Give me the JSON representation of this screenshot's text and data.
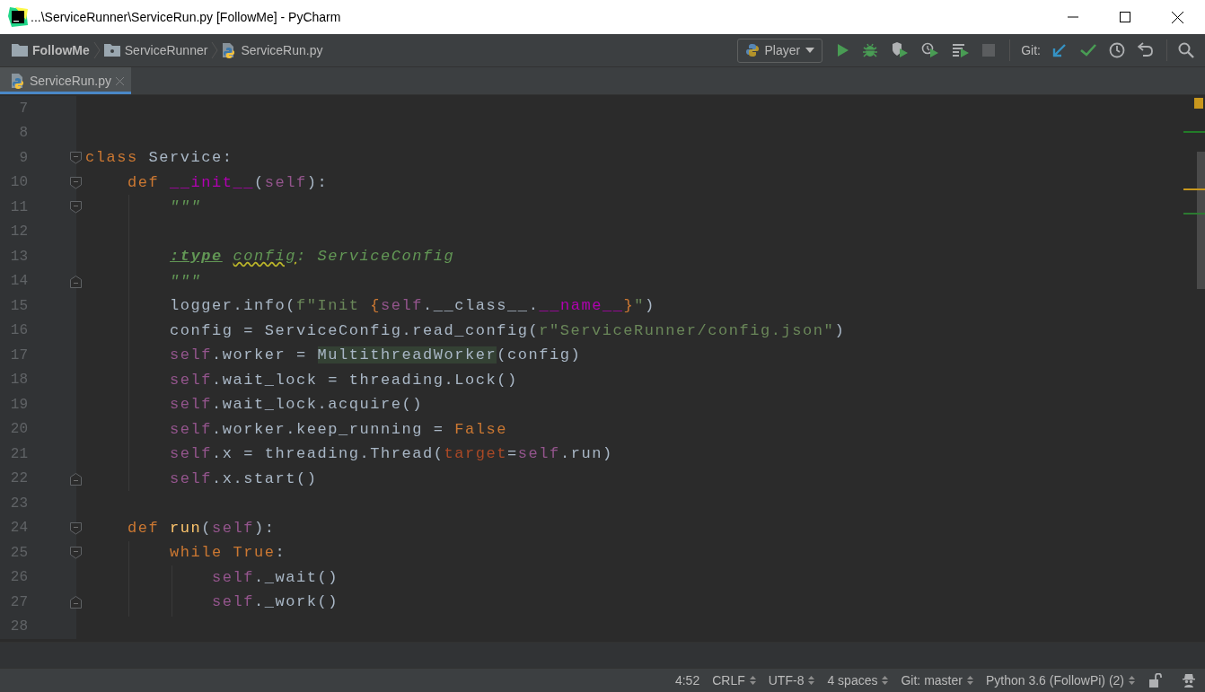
{
  "window": {
    "title": "...\\ServiceRunner\\ServiceRun.py [FollowMe] - PyCharm"
  },
  "breadcrumbs": [
    {
      "label": "FollowMe",
      "kind": "project"
    },
    {
      "label": "ServiceRunner",
      "kind": "package"
    },
    {
      "label": "ServiceRun.py",
      "kind": "file"
    }
  ],
  "run_configuration": {
    "label": "Player"
  },
  "toolbar": {
    "git_label": "Git:"
  },
  "tabs": [
    {
      "label": "ServiceRun.py",
      "selected": true
    }
  ],
  "editor": {
    "lines": [
      {
        "number": "7",
        "fold_start": false,
        "fold_end": false
      },
      {
        "number": "8",
        "fold_start": false,
        "fold_end": false
      },
      {
        "number": "9",
        "fold_start": true,
        "fold_end": false,
        "tokens": [
          {
            "text": "class",
            "kind": "keyword"
          },
          {
            "text": " Service:",
            "kind": "plain"
          }
        ]
      },
      {
        "number": "10",
        "fold_start": true,
        "fold_end": false,
        "tokens": [
          {
            "text": "    def ",
            "kind": "keyword"
          },
          {
            "text": "__init__",
            "kind": "magic"
          },
          {
            "text": "(",
            "kind": "plain"
          },
          {
            "text": "self",
            "kind": "self"
          },
          {
            "text": "):",
            "kind": "plain"
          }
        ]
      },
      {
        "number": "11",
        "fold_start": true,
        "fold_end": false,
        "tokens": [
          {
            "text": "        \"\"\"",
            "kind": "doc"
          }
        ]
      },
      {
        "number": "12",
        "fold_start": false,
        "fold_end": false
      },
      {
        "number": "13",
        "fold_start": false,
        "fold_end": false,
        "tokens": [
          {
            "text": "        :type ",
            "kind": "doctag"
          },
          {
            "text": "config",
            "kind": "docwarn"
          },
          {
            "text": ": ServiceConfig",
            "kind": "doc"
          }
        ]
      },
      {
        "number": "14",
        "fold_start": false,
        "fold_end": true,
        "tokens": [
          {
            "text": "        \"\"\"",
            "kind": "doc"
          }
        ]
      },
      {
        "number": "15",
        "fold_start": false,
        "fold_end": false,
        "tokens": [
          {
            "text": "        logger.info(",
            "kind": "plain"
          },
          {
            "text": "f\"Init ",
            "kind": "string"
          },
          {
            "text": "{",
            "kind": "brace"
          },
          {
            "text": "self",
            "kind": "self"
          },
          {
            "text": ".__class__.",
            "kind": "plain"
          },
          {
            "text": "__name__",
            "kind": "magic"
          },
          {
            "text": "}",
            "kind": "brace"
          },
          {
            "text": "\"",
            "kind": "string"
          },
          {
            "text": ")",
            "kind": "plain"
          }
        ]
      },
      {
        "number": "16",
        "fold_start": false,
        "fold_end": false,
        "tokens": [
          {
            "text": "        config = ServiceConfig.read_config(",
            "kind": "plain"
          },
          {
            "text": "r\"ServiceRunner/config.json\"",
            "kind": "string"
          },
          {
            "text": ")",
            "kind": "plain"
          }
        ]
      },
      {
        "number": "17",
        "fold_start": false,
        "fold_end": false,
        "tokens": [
          {
            "text": "        self",
            "kind": "self"
          },
          {
            "text": ".worker = ",
            "kind": "plain"
          },
          {
            "text": "MultithreadWorker",
            "kind": "highlight"
          },
          {
            "text": "(config)",
            "kind": "plain"
          }
        ]
      },
      {
        "number": "18",
        "fold_start": false,
        "fold_end": false,
        "tokens": [
          {
            "text": "        self",
            "kind": "self"
          },
          {
            "text": ".wait_lock = threading.Lock()",
            "kind": "plain"
          }
        ]
      },
      {
        "number": "19",
        "fold_start": false,
        "fold_end": false,
        "tokens": [
          {
            "text": "        self",
            "kind": "self"
          },
          {
            "text": ".wait_lock.acquire()",
            "kind": "plain"
          }
        ]
      },
      {
        "number": "20",
        "fold_start": false,
        "fold_end": false,
        "tokens": [
          {
            "text": "        self",
            "kind": "self"
          },
          {
            "text": ".worker.keep_running = ",
            "kind": "plain"
          },
          {
            "text": "False",
            "kind": "keyword"
          }
        ]
      },
      {
        "number": "21",
        "fold_start": false,
        "fold_end": false,
        "tokens": [
          {
            "text": "        self",
            "kind": "self"
          },
          {
            "text": ".x = threading.Thread(",
            "kind": "plain"
          },
          {
            "text": "target",
            "kind": "param"
          },
          {
            "text": "=",
            "kind": "plain"
          },
          {
            "text": "self",
            "kind": "self"
          },
          {
            "text": ".run)",
            "kind": "plain"
          }
        ]
      },
      {
        "number": "22",
        "fold_start": false,
        "fold_end": true,
        "tokens": [
          {
            "text": "        self",
            "kind": "self"
          },
          {
            "text": ".x.start()",
            "kind": "plain"
          }
        ]
      },
      {
        "number": "23",
        "fold_start": false,
        "fold_end": false
      },
      {
        "number": "24",
        "fold_start": true,
        "fold_end": false,
        "tokens": [
          {
            "text": "    def ",
            "kind": "keyword"
          },
          {
            "text": "run",
            "kind": "fndef"
          },
          {
            "text": "(",
            "kind": "plain"
          },
          {
            "text": "self",
            "kind": "self"
          },
          {
            "text": "):",
            "kind": "plain"
          }
        ]
      },
      {
        "number": "25",
        "fold_start": true,
        "fold_end": false,
        "tokens": [
          {
            "text": "        while True",
            "kind": "keyword"
          },
          {
            "text": ":",
            "kind": "plain"
          }
        ]
      },
      {
        "number": "26",
        "fold_start": false,
        "fold_end": false,
        "tokens": [
          {
            "text": "            self",
            "kind": "self"
          },
          {
            "text": "._wait()",
            "kind": "plain"
          }
        ]
      },
      {
        "number": "27",
        "fold_start": false,
        "fold_end": true,
        "tokens": [
          {
            "text": "            self",
            "kind": "self"
          },
          {
            "text": "._work()",
            "kind": "plain"
          }
        ]
      },
      {
        "number": "28",
        "fold_start": false,
        "fold_end": false
      }
    ]
  },
  "status_bar": {
    "items": [
      {
        "label": "4:52",
        "kind": "text"
      },
      {
        "label": "CRLF",
        "kind": "select"
      },
      {
        "label": "UTF-8",
        "kind": "select"
      },
      {
        "label": "4 spaces",
        "kind": "select"
      },
      {
        "label": "Git: master",
        "kind": "select"
      },
      {
        "label": "Python 3.6 (FollowPi) (2)",
        "kind": "select"
      }
    ]
  }
}
